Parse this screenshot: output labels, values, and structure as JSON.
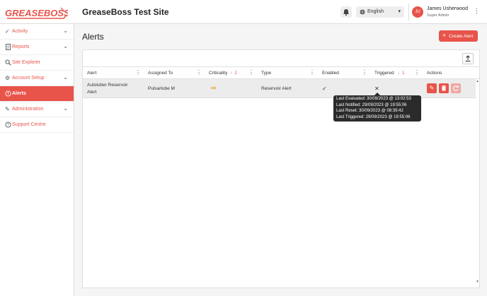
{
  "app": {
    "logo_text": "GREASEBOSS",
    "site_title": "GreaseBoss Test Site",
    "brand_color": "#e8534a"
  },
  "header": {
    "language": "English",
    "user": {
      "initials": "JU",
      "name": "James Usherwood",
      "role": "Super Admin"
    }
  },
  "sidebar": {
    "items": [
      {
        "label": "Activity",
        "icon": "check-icon",
        "expandable": true
      },
      {
        "label": "Reports",
        "icon": "document-icon",
        "expandable": true
      },
      {
        "label": "Site Explorer",
        "icon": "search-icon",
        "expandable": false
      },
      {
        "label": "Account Setup",
        "icon": "gear-icon",
        "expandable": true
      },
      {
        "label": "Alerts",
        "icon": "alert-icon",
        "expandable": false,
        "active": true
      },
      {
        "label": "Administration",
        "icon": "pencil-icon",
        "expandable": true
      },
      {
        "label": "Support Centre",
        "icon": "help-icon",
        "expandable": false
      }
    ]
  },
  "main": {
    "title": "Alerts",
    "create_label": "Create Alert",
    "table": {
      "columns": [
        {
          "label": "Alert"
        },
        {
          "label": "Assigned To"
        },
        {
          "label": "Criticality",
          "sort": "asc",
          "sort_order": "2"
        },
        {
          "label": "Type"
        },
        {
          "label": "Enabled"
        },
        {
          "label": "Triggered",
          "sort": "desc",
          "sort_order": "1"
        },
        {
          "label": "Actions"
        }
      ],
      "rows": [
        {
          "alert": "Autoluber Reservoir Alert",
          "alert_line1": "Autoluber Reservoir",
          "alert_line2": "Alert",
          "assigned_to": "Pulsarlube M",
          "criticality": "medium",
          "type": "Reservoir Alert",
          "enabled": "✓",
          "triggered": "✕"
        }
      ]
    },
    "tooltip": {
      "last_evaluated": "Last Evaluated: 30/09/2023 @ 13:02:53",
      "last_notified": "Last Notified: 29/09/2023 @ 19:55:06",
      "last_reset": "Last Reset: 30/09/2023 @ 08:39:42",
      "last_triggered": "Last Triggered: 29/09/2023 @ 19:55:06"
    }
  }
}
